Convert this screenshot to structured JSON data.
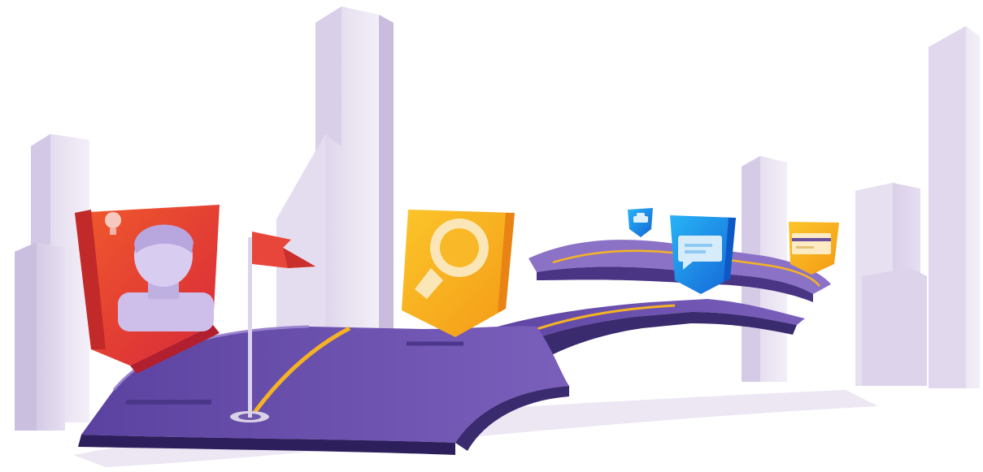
{
  "scene": {
    "description_free": true,
    "colors": {
      "background": "#ffffff",
      "building_light": "#ece6f4",
      "building_mid": "#d7cde6",
      "building_shade": "#c4b6da",
      "road_top": "#6a4fa6",
      "road_side": "#3a2a6e",
      "road_edge": "#8d74c4",
      "road_line": "#f5b324",
      "shadow": "#e9e3f1",
      "red_marker": "#e8452f",
      "red_marker_dark": "#c42a2a",
      "yellow_marker": "#f7b51f",
      "yellow_marker_dark": "#ef8f1a",
      "blue_marker": "#1f9bf0",
      "blue_marker_dark": "#1266d8",
      "flag": "#e8463a",
      "person": "#cfc3ea"
    },
    "icons": [
      "person-icon",
      "lightbulb-icon",
      "magnifier-icon",
      "car-icon",
      "chat-bubble-icon",
      "credit-card-icon",
      "flag-icon"
    ]
  }
}
